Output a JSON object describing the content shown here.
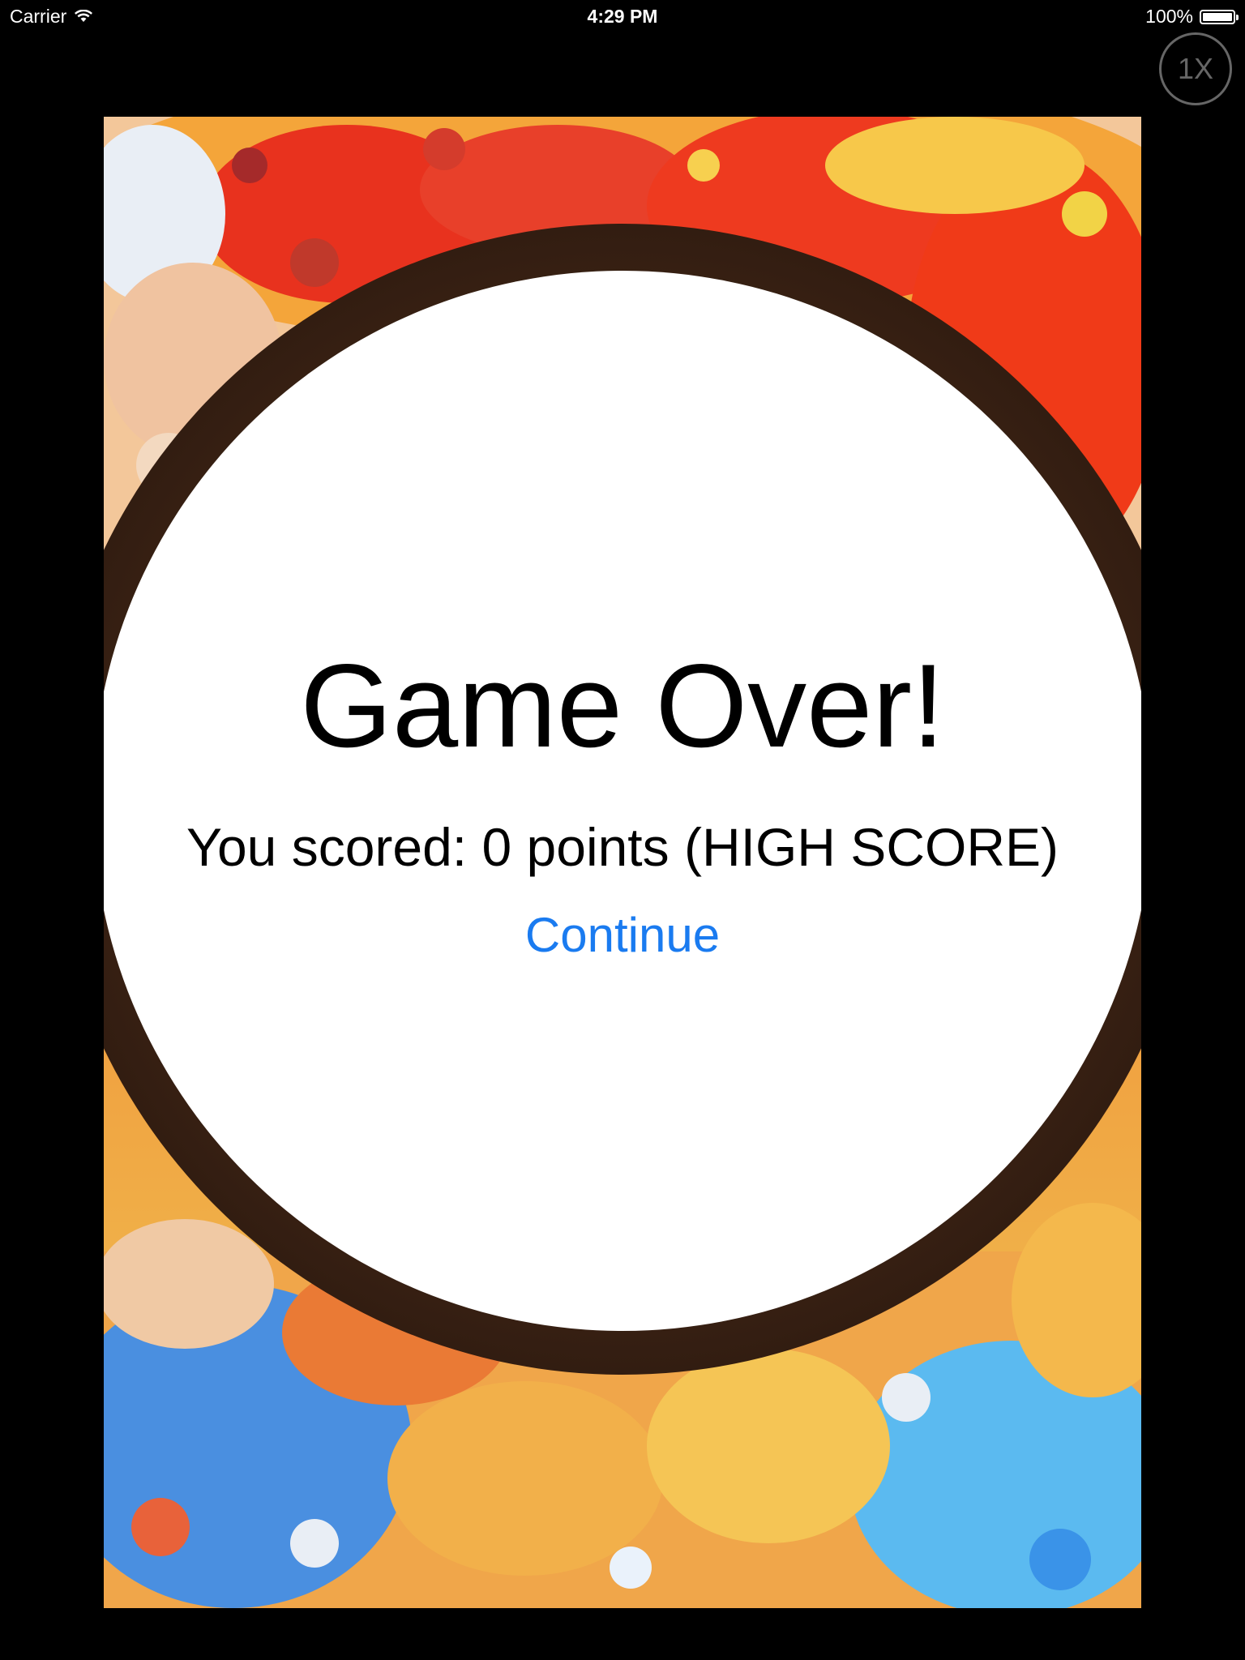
{
  "status_bar": {
    "carrier": "Carrier",
    "time": "4:29 PM",
    "battery_percent": "100%",
    "battery_level": 1.0,
    "wifi_icon": "wifi-icon",
    "battery_icon": "battery-icon"
  },
  "zoom_button": {
    "label": "1X"
  },
  "game_over": {
    "title": "Game Over!",
    "score_text": "You scored: 0 points (HIGH SCORE)",
    "continue_label": "Continue"
  },
  "colors": {
    "background": "#000000",
    "link_blue": "#1a7bf0",
    "ring_dark": "#2a1710",
    "circle_white": "#ffffff"
  }
}
